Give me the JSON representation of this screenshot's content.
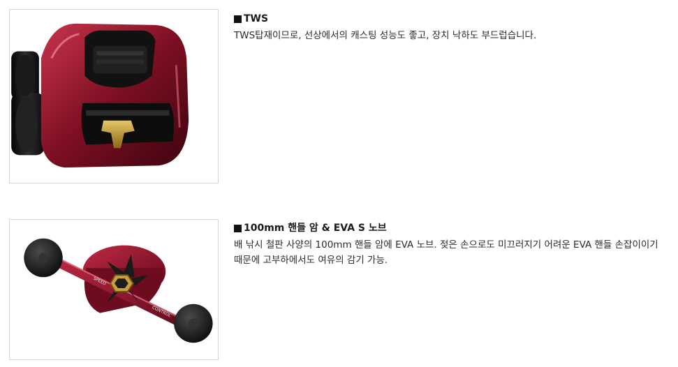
{
  "features": [
    {
      "title": "TWS",
      "description": "TWS탑재이므로, 선상에서의 캐스팅 성능도 좋고, 장치 낙하도 부드럽습니다."
    },
    {
      "title": "100mm 핸들 암 & EVA S 노브",
      "description": "배 낚시 철판 사양의 100mm 핸들 암에 EVA 노브. 젖은 손으로도 미끄러지기 어려운 EVA 핸들 손잡이이기 때문에 고부하에서도 여유의 감기 가능.",
      "photo_text": [
        "SPEED",
        "CONTROL"
      ]
    }
  ],
  "colors": {
    "reel_red": "#8b1228",
    "gold": "#c9a040",
    "black": "#151515"
  }
}
